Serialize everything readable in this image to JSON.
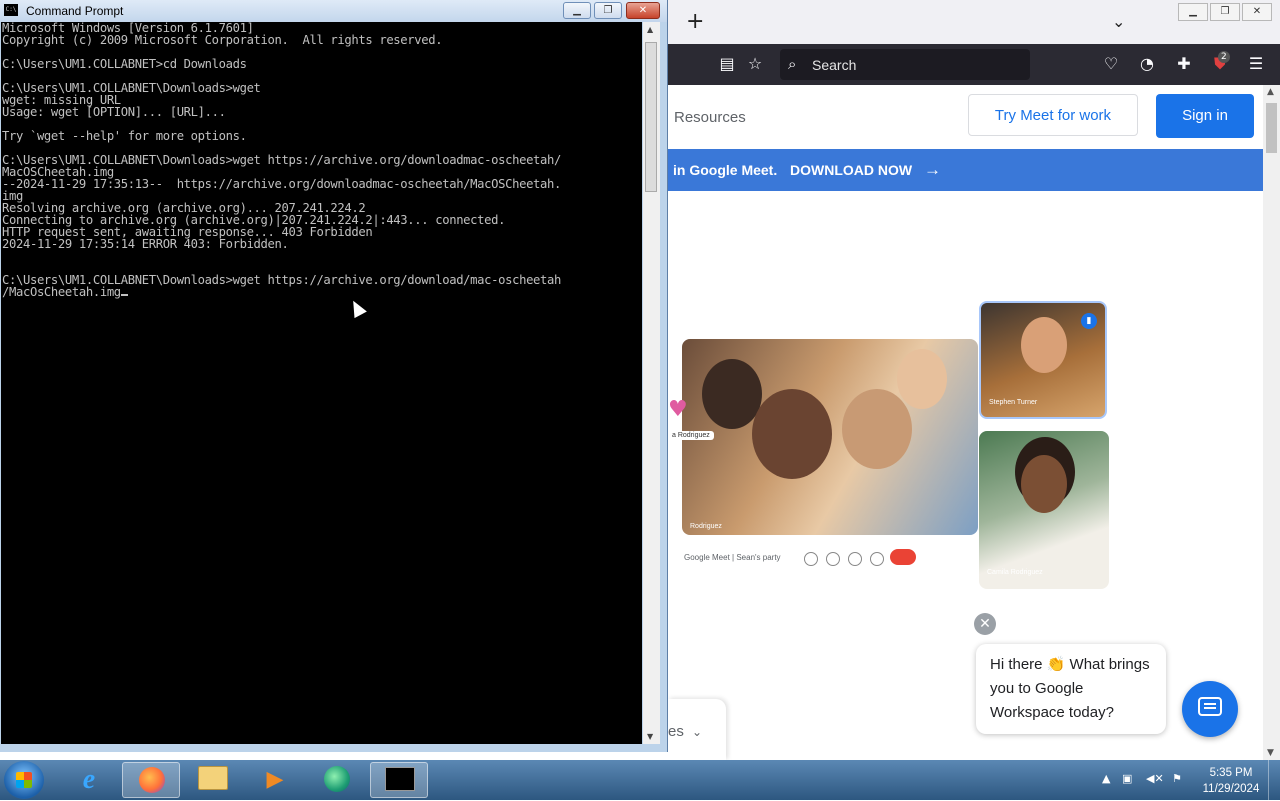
{
  "cmd_window": {
    "title": "Command Prompt",
    "lines": [
      "Microsoft Windows [Version 6.1.7601]",
      "Copyright (c) 2009 Microsoft Corporation.  All rights reserved.",
      "",
      "C:\\Users\\UM1.COLLABNET>cd Downloads",
      "",
      "C:\\Users\\UM1.COLLABNET\\Downloads>wget",
      "wget: missing URL",
      "Usage: wget [OPTION]... [URL]...",
      "",
      "Try `wget --help' for more options.",
      "",
      "C:\\Users\\UM1.COLLABNET\\Downloads>wget https://archive.org/downloadmac-oscheetah/",
      "MacOSCheetah.img",
      "--2024-11-29 17:35:13--  https://archive.org/downloadmac-oscheetah/MacOSCheetah.",
      "img",
      "Resolving archive.org (archive.org)... 207.241.224.2",
      "Connecting to archive.org (archive.org)|207.241.224.2|:443... connected.",
      "HTTP request sent, awaiting response... 403 Forbidden",
      "2024-11-29 17:35:14 ERROR 403: Forbidden.",
      "",
      "",
      "C:\\Users\\UM1.COLLABNET\\Downloads>wget https://archive.org/download/mac-oscheetah",
      "/MacOsCheetah.img"
    ],
    "buttons": {
      "minimize": "▁",
      "maximize": "❐",
      "close": "✕"
    }
  },
  "browser": {
    "new_tab": "+",
    "tabs_dropdown": "⌄",
    "search_placeholder": "Search",
    "extension_badge": "2",
    "page": {
      "nav_resources": "Resources",
      "try_meet": "Try Meet for work",
      "sign_in": "Sign in",
      "banner_text": "in Google Meet.",
      "banner_cta": "DOWNLOAD NOW",
      "banner_arrow": "→",
      "meet_bar_label": "Google Meet  |  Sean's party",
      "tile1_name": "Stephen Turner",
      "tile2_name": "Camila Rodriguez",
      "main_name": "Rodriguez",
      "chip_name": "a Rodriguez",
      "chat_close": "✕",
      "chat_message": "Hi there 👏 What brings you to Google Workspace today?",
      "bottom_card_text": "es"
    }
  },
  "taskbar": {
    "time": "5:35 PM",
    "date": "11/29/2024",
    "apps": [
      "internet-explorer",
      "firefox",
      "file-explorer",
      "media-player",
      "app-green",
      "command-prompt"
    ]
  },
  "colors": {
    "meet_blue": "#1a73e8",
    "banner_blue": "#3a78d8",
    "console_text": "#c0c0c0"
  }
}
